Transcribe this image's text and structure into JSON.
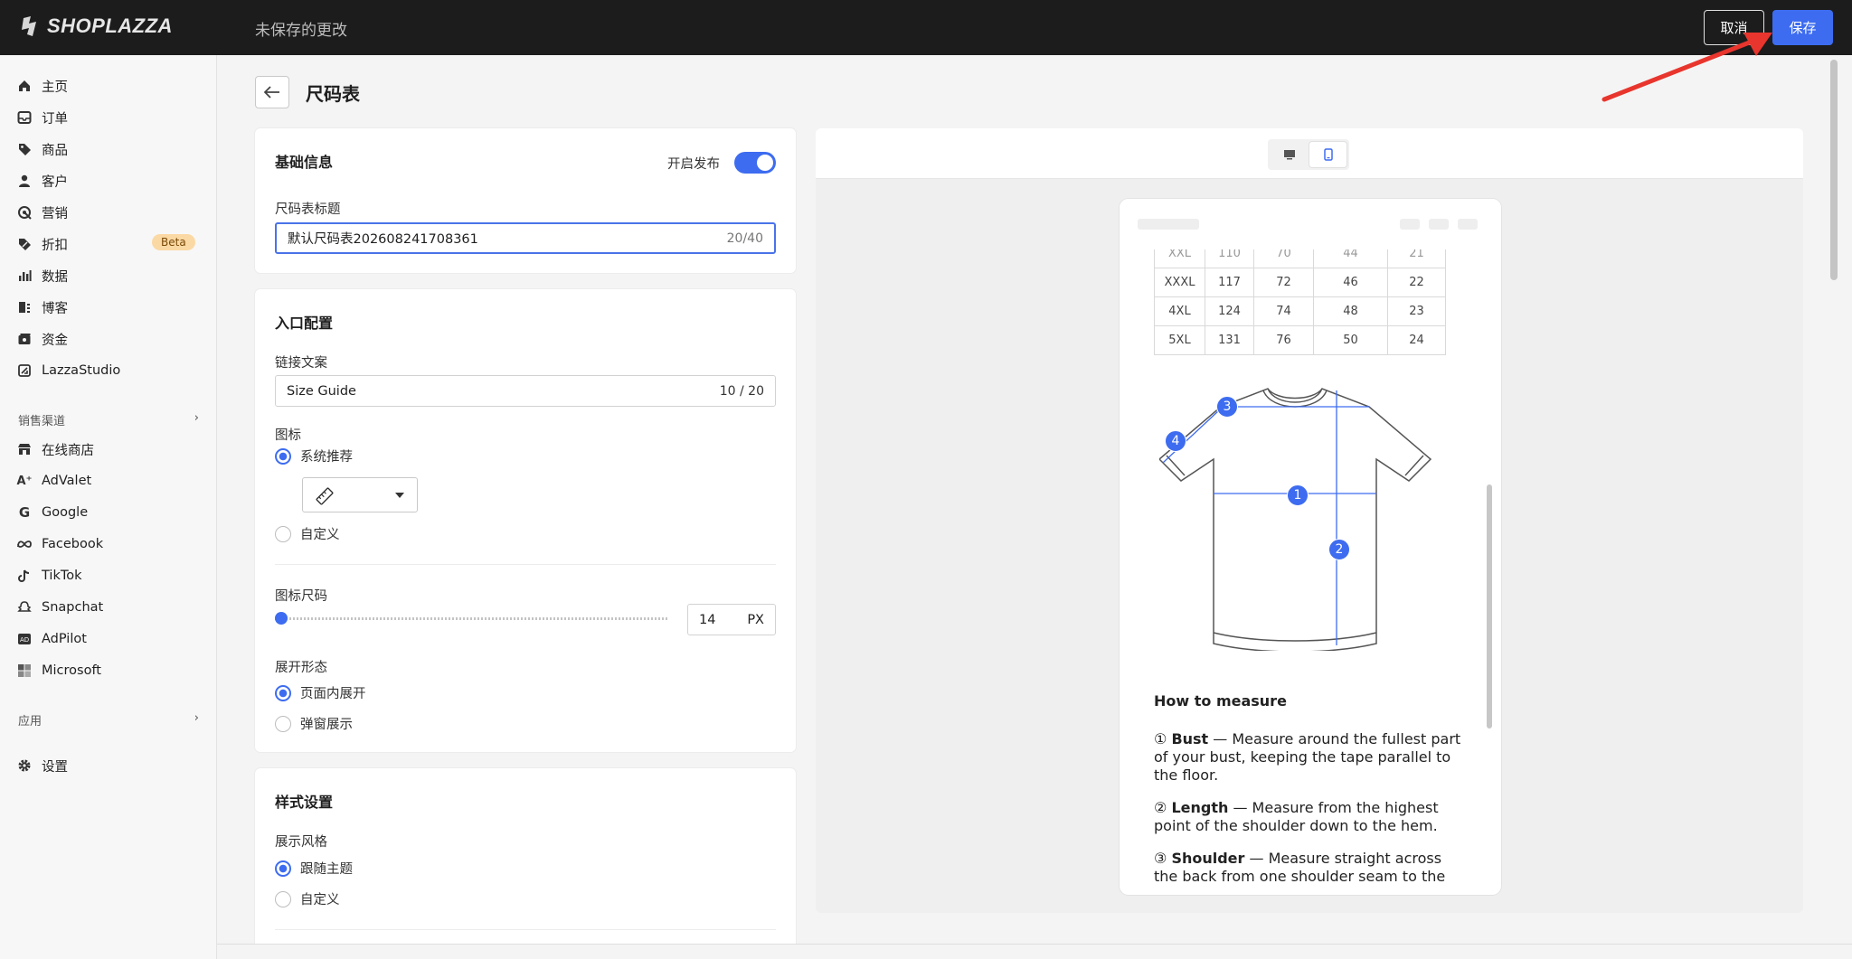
{
  "topbar": {
    "logo_text": "SHOPLAZZA",
    "unsaved_text": "未保存的更改",
    "cancel_label": "取消",
    "save_label": "保存"
  },
  "sidebar": {
    "items": [
      {
        "label": "主页",
        "icon": "home-icon"
      },
      {
        "label": "订单",
        "icon": "inbox-icon"
      },
      {
        "label": "商品",
        "icon": "tag-icon"
      },
      {
        "label": "客户",
        "icon": "person-icon"
      },
      {
        "label": "营销",
        "icon": "target-icon"
      },
      {
        "label": "折扣",
        "icon": "discount-icon",
        "badge": "Beta"
      },
      {
        "label": "数据",
        "icon": "bar-chart-icon"
      },
      {
        "label": "博客",
        "icon": "blog-icon"
      },
      {
        "label": "资金",
        "icon": "wallet-icon"
      },
      {
        "label": "LazzaStudio",
        "icon": "studio-icon"
      }
    ],
    "channels_header": "销售渠道",
    "channels": [
      {
        "label": "在线商店",
        "icon": "store-icon"
      },
      {
        "label": "AdValet",
        "icon": "advalet-icon"
      },
      {
        "label": "Google",
        "icon": "google-icon"
      },
      {
        "label": "Facebook",
        "icon": "meta-icon"
      },
      {
        "label": "TikTok",
        "icon": "tiktok-icon"
      },
      {
        "label": "Snapchat",
        "icon": "snapchat-icon"
      },
      {
        "label": "AdPilot",
        "icon": "adpilot-icon"
      },
      {
        "label": "Microsoft",
        "icon": "microsoft-icon"
      }
    ],
    "apps_header": "应用",
    "settings_label": "设置"
  },
  "page": {
    "title": "尺码表"
  },
  "basic": {
    "title": "基础信息",
    "publish_label": "开启发布",
    "publish_on": true,
    "name_label": "尺码表标题",
    "name_value": "默认尺码表202608241708361",
    "name_count": "20/40"
  },
  "entry": {
    "title": "入口配置",
    "link_label": "链接文案",
    "link_value": "Size Guide",
    "link_count": "10 / 20",
    "icon_label": "图标",
    "icon_opt_system": "系统推荐",
    "icon_opt_custom": "自定义",
    "icon_select": "ruler-icon",
    "size_label": "图标尺码",
    "size_value": "14",
    "size_unit": "PX",
    "size_slider_fraction": 0.0,
    "expand_label": "展开形态",
    "expand_opt_inline": "页面内展开",
    "expand_opt_popup": "弹窗展示"
  },
  "style": {
    "title": "样式设置",
    "display_label": "展示风格",
    "opt_theme": "跟随主题",
    "opt_custom": "自定义"
  },
  "preview": {
    "table_rows": [
      [
        "XXXL",
        "117",
        "72",
        "46",
        "22"
      ],
      [
        "4XL",
        "124",
        "74",
        "48",
        "23"
      ],
      [
        "5XL",
        "131",
        "76",
        "50",
        "24"
      ]
    ],
    "markers": [
      "1",
      "2",
      "3",
      "4"
    ],
    "how_title": "How to measure",
    "items": [
      {
        "num": "①",
        "term": "Bust",
        "text": " — Measure around the fullest part of your bust, keeping the tape parallel to the floor."
      },
      {
        "num": "②",
        "term": "Length",
        "text": " — Measure from the highest point of the shoulder down to the hem."
      },
      {
        "num": "③",
        "term": "Shoulder",
        "text": " — Measure straight across the back from one shoulder seam to the"
      }
    ]
  },
  "colors": {
    "accent": "#3d6cf0",
    "topbar": "#1c1c1c",
    "beta_bg": "#fbd9a4"
  }
}
